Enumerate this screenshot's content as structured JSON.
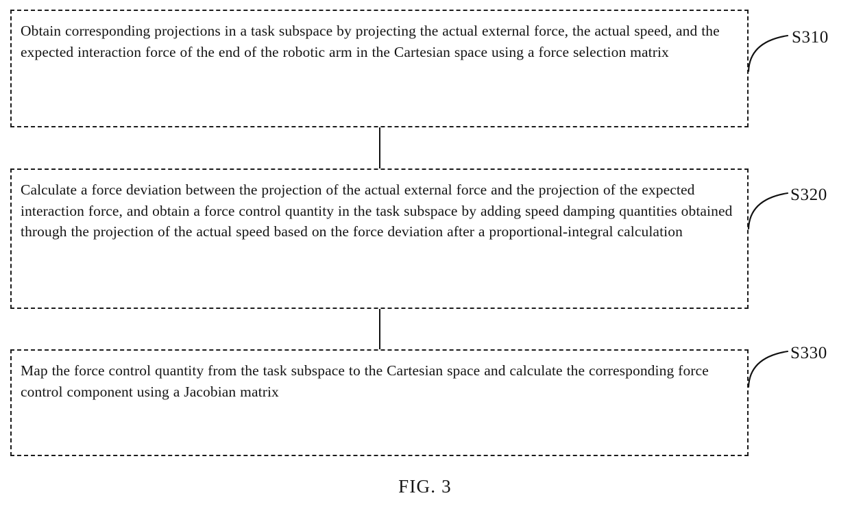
{
  "figure": {
    "caption": "FIG. 3",
    "type": "patent-flowchart",
    "ink_color": "#141414",
    "background_color": "#ffffff"
  },
  "steps": [
    {
      "id": "S310",
      "label": "S310",
      "text": "Obtain corresponding projections in a task subspace by projecting the actual external force, the actual speed, and the expected interaction force of the end of the robotic arm in the Cartesian space using a force selection matrix"
    },
    {
      "id": "S320",
      "label": "S320",
      "text": "Calculate a force deviation between the projection of the actual external force and the projection of the expected interaction force, and obtain a force control quantity in the task subspace by adding speed damping quantities obtained through the projection of the actual speed based on the force deviation after a proportional-integral calculation"
    },
    {
      "id": "S330",
      "label": "S330",
      "text": "Map the force control quantity from the task subspace to the Cartesian space and calculate the corresponding force control component using a Jacobian matrix"
    }
  ]
}
